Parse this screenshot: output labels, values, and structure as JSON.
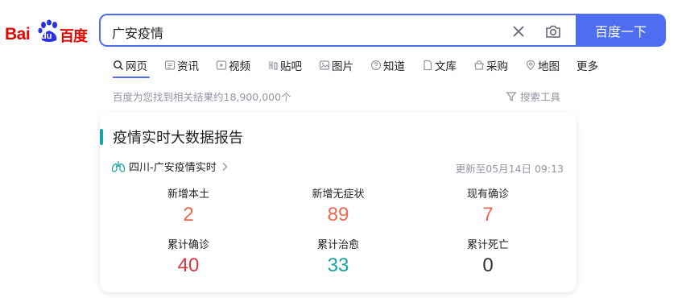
{
  "logo": {
    "latin": "Bai",
    "paw_text": "du",
    "chinese": "百度"
  },
  "search": {
    "value": "广安疫情",
    "button_label": "百度一下"
  },
  "tabs": [
    {
      "label": "网页",
      "icon": "search-icon"
    },
    {
      "label": "资讯",
      "icon": "news-icon"
    },
    {
      "label": "视频",
      "icon": "video-icon"
    },
    {
      "label": "贴吧",
      "icon": "tieba-icon"
    },
    {
      "label": "图片",
      "icon": "image-icon"
    },
    {
      "label": "知道",
      "icon": "question-icon"
    },
    {
      "label": "文库",
      "icon": "document-icon"
    },
    {
      "label": "采购",
      "icon": "shop-icon"
    },
    {
      "label": "地图",
      "icon": "map-icon"
    },
    {
      "label": "更多",
      "icon": ""
    }
  ],
  "result_count": "百度为您找到相关结果约18,900,000个",
  "search_tools": "搜索工具",
  "card": {
    "title": "疫情实时大数据报告",
    "region": "四川-广安疫情实时",
    "update_time": "更新至05月14日 09:13",
    "stats": [
      {
        "label": "新增本土",
        "value": "2",
        "color": "#e8694f"
      },
      {
        "label": "新增无症状",
        "value": "89",
        "color": "#e8694f"
      },
      {
        "label": "现有确诊",
        "value": "7",
        "color": "#e8694f"
      },
      {
        "label": "累计确诊",
        "value": "40",
        "color": "#d9363e"
      },
      {
        "label": "累计治愈",
        "value": "33",
        "color": "#1aa1a1"
      },
      {
        "label": "累计死亡",
        "value": "0",
        "color": "#333333"
      }
    ]
  },
  "colors": {
    "brand_blue": "#4e6ef2",
    "brand_red": "#e10602",
    "accent_teal": "#1aa1a1",
    "muted": "#9195a3"
  }
}
